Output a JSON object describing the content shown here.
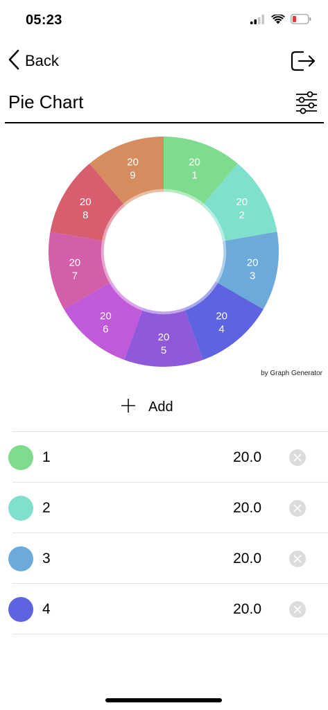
{
  "status_bar": {
    "time": "05:23"
  },
  "nav": {
    "back_label": "Back"
  },
  "page": {
    "title": "Pie Chart"
  },
  "chart_data": {
    "type": "pie",
    "hole": 0.52,
    "credit": "by Graph Generator",
    "slices": [
      {
        "name": "1",
        "value": 20,
        "color": "#7fdc8e",
        "label_top": "20",
        "label_bottom": "1"
      },
      {
        "name": "2",
        "value": 20,
        "color": "#7fe0cd",
        "label_top": "20",
        "label_bottom": "2"
      },
      {
        "name": "3",
        "value": 20,
        "color": "#6daadc",
        "label_top": "20",
        "label_bottom": "3"
      },
      {
        "name": "4",
        "value": 20,
        "color": "#5e63df",
        "label_top": "20",
        "label_bottom": "4"
      },
      {
        "name": "5",
        "value": 20,
        "color": "#8e5adb",
        "label_top": "20",
        "label_bottom": "5"
      },
      {
        "name": "6",
        "value": 20,
        "color": "#c05ad9",
        "label_top": "20",
        "label_bottom": "6"
      },
      {
        "name": "7",
        "value": 20,
        "color": "#d35ea9",
        "label_top": "20",
        "label_bottom": "7"
      },
      {
        "name": "8",
        "value": 20,
        "color": "#d75e6e",
        "label_top": "20",
        "label_bottom": "8"
      },
      {
        "name": "9",
        "value": 20,
        "color": "#d68c5e",
        "label_top": "20",
        "label_bottom": "9"
      }
    ]
  },
  "add": {
    "label": "Add"
  },
  "list": {
    "items": [
      {
        "label": "1",
        "value": "20.0",
        "color": "#7fdc8e"
      },
      {
        "label": "2",
        "value": "20.0",
        "color": "#7fe0cd"
      },
      {
        "label": "3",
        "value": "20.0",
        "color": "#6daadc"
      },
      {
        "label": "4",
        "value": "20.0",
        "color": "#5e63df"
      }
    ]
  }
}
